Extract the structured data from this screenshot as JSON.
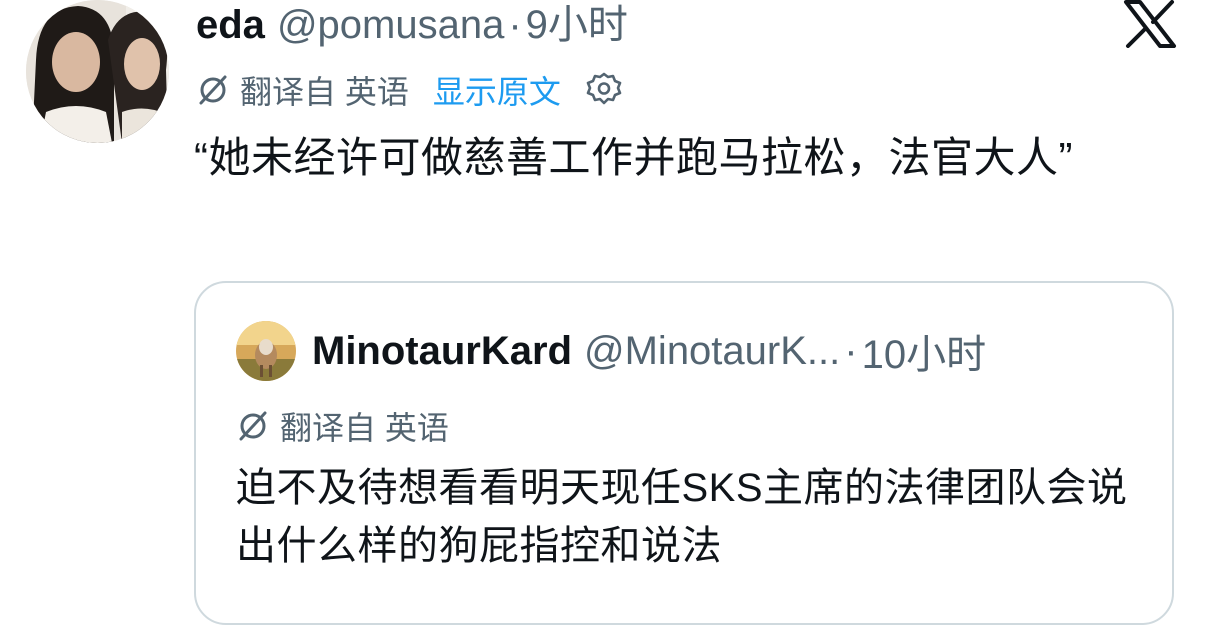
{
  "tweet": {
    "author": {
      "display_name": "eda",
      "handle": "@pomusana",
      "separator": "·",
      "time": "9小时"
    },
    "translation": {
      "label": "翻译自 英语",
      "show_original": "显示原文"
    },
    "text": "“她未经许可做慈善工作并跑马拉松，法官大人”"
  },
  "quote": {
    "author": {
      "display_name": "MinotaurKard",
      "handle": "@MinotaurK...",
      "separator": "·",
      "time": "10小时"
    },
    "translation": {
      "label": "翻译自 英语"
    },
    "text": "迫不及待想看看明天现任SKS主席的法律团队会说出什么样的狗屁指控和说法"
  },
  "icons": {
    "translate": "translate-icon",
    "settings": "gear-icon",
    "brand": "x-logo-icon"
  },
  "colors": {
    "primary_text": "#0f1419",
    "secondary_text": "#536471",
    "link": "#1d9bf0",
    "border": "#cfd9de"
  }
}
